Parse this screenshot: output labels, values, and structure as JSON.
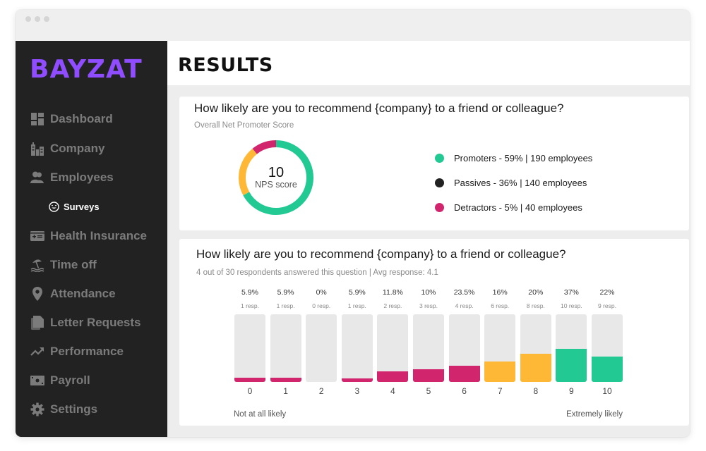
{
  "colors": {
    "brand": "#8f4dff",
    "promoter": "#22c993",
    "passive": "#ffb836",
    "detractor": "#d1266e",
    "passive_legend": "#222222"
  },
  "sidebar": {
    "logo": "BAYZAT",
    "items": [
      {
        "label": "Dashboard",
        "icon": "dashboard-icon"
      },
      {
        "label": "Company",
        "icon": "company-icon"
      },
      {
        "label": "Employees",
        "icon": "employees-icon"
      },
      {
        "label": "Surveys",
        "icon": "surveys-icon",
        "sub": true,
        "active": true
      },
      {
        "label": "Health Insurance",
        "icon": "health-insurance-icon"
      },
      {
        "label": "Time off",
        "icon": "time-off-icon"
      },
      {
        "label": "Attendance",
        "icon": "attendance-icon"
      },
      {
        "label": "Letter Requests",
        "icon": "letter-requests-icon"
      },
      {
        "label": "Performance",
        "icon": "performance-icon"
      },
      {
        "label": "Payroll",
        "icon": "payroll-icon"
      },
      {
        "label": "Settings",
        "icon": "settings-icon"
      }
    ]
  },
  "header": {
    "title": "RESULTS"
  },
  "nps_card": {
    "question": "How likely are you to recommend {company} to a friend or colleague?",
    "subtitle": "Overall Net Promoter Score",
    "score": "10",
    "score_label": "NPS score",
    "legend": [
      {
        "key": "promoter",
        "text": "Promoters - 59% | 190 employees"
      },
      {
        "key": "passive",
        "text": "Passives - 36% | 140 employees"
      },
      {
        "key": "detractor",
        "text": "Detractors - 5% | 40 employees"
      }
    ]
  },
  "distribution_card": {
    "question": "How likely are you to recommend {company} to a friend or colleague?",
    "subtitle": "4 out of 30 respondents answered this question  |  Avg response: 4.1",
    "scale_low": "Not at all likely",
    "scale_high": "Extremely likely"
  },
  "chart_data": [
    {
      "type": "pie",
      "title": "Overall Net Promoter Score",
      "center_label": "10 NPS score",
      "slices": [
        {
          "name": "Promoters",
          "percent": 59,
          "count": 190,
          "color": "#22c993"
        },
        {
          "name": "Passives",
          "percent": 36,
          "count": 140,
          "color": "#ffb836"
        },
        {
          "name": "Detractors",
          "percent": 5,
          "count": 40,
          "color": "#d1266e"
        }
      ],
      "donut_visual_fractions": {
        "Promoters": 0.67,
        "Passives": 0.22,
        "Detractors": 0.11
      }
    },
    {
      "type": "bar",
      "title": "How likely are you to recommend {company} to a friend or colleague?",
      "categories": [
        "0",
        "1",
        "2",
        "3",
        "4",
        "5",
        "6",
        "7",
        "8",
        "9",
        "10"
      ],
      "percent_labels": [
        "5.9%",
        "5.9%",
        "0%",
        "5.9%",
        "11.8%",
        "10%",
        "23.5%",
        "16%",
        "20%",
        "37%",
        "22%"
      ],
      "responses_labels": [
        "1 resp.",
        "1 resp.",
        "0 resp.",
        "1 resp.",
        "2 resp.",
        "3 resp.",
        "4 resp.",
        "6 resp.",
        "8 resp.",
        "10 resp.",
        "9 resp."
      ],
      "responses": [
        1,
        1,
        0,
        1,
        2,
        3,
        4,
        6,
        8,
        10,
        9
      ],
      "fill_fraction": [
        0.06,
        0.06,
        0,
        0.05,
        0.16,
        0.19,
        0.24,
        0.3,
        0.42,
        0.49,
        0.38
      ],
      "group": [
        "detractor",
        "detractor",
        "detractor",
        "detractor",
        "detractor",
        "detractor",
        "detractor",
        "passive",
        "passive",
        "promoter",
        "promoter"
      ],
      "xlabel_left": "Not at all likely",
      "xlabel_right": "Extremely likely"
    }
  ]
}
